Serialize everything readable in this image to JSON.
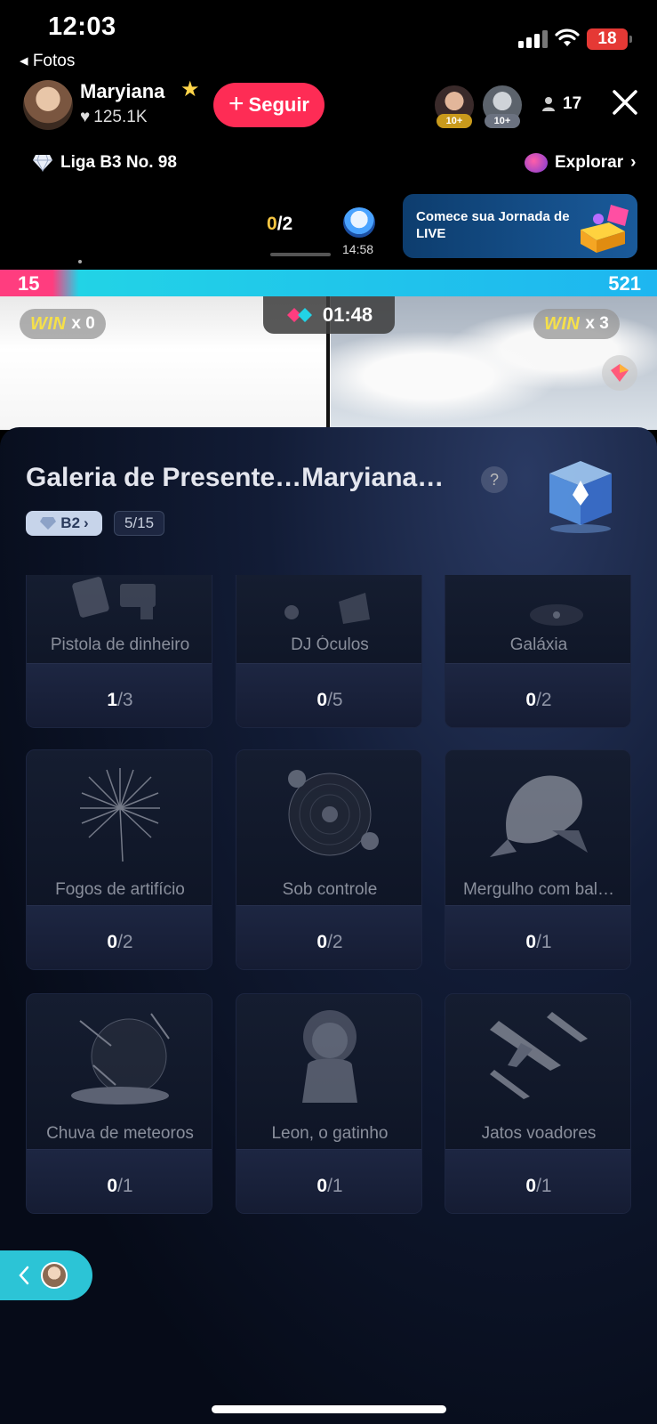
{
  "status_bar": {
    "time": "12:03",
    "battery": "18",
    "back_app": "◂ Fotos"
  },
  "host": {
    "name": "Maryiana",
    "likes": "125.1K",
    "follow_label": "Seguir"
  },
  "viewers": {
    "avatar_badges": [
      "10+",
      "10+"
    ],
    "count": "17"
  },
  "league": {
    "label": "Liga B3 No. 98"
  },
  "explore": {
    "label": "Explorar"
  },
  "mini": {
    "progress_done": "0",
    "progress_total": "/2",
    "time": "14:58"
  },
  "promo": {
    "text": "Comece sua Jornada de LIVE"
  },
  "battle": {
    "score_left": "15",
    "score_right": "521",
    "timer": "01:48",
    "left_win_label": "WIN",
    "left_win_count": "x 0",
    "right_win_label": "WIN",
    "right_win_count": "x 3"
  },
  "gallery": {
    "title": "Galeria de Presente…Maryiana…",
    "help": "?",
    "tier": "B2",
    "collected": "5/15",
    "items": [
      {
        "name": "Pistola de dinheiro",
        "have": "1",
        "total": "/3"
      },
      {
        "name": "DJ Óculos",
        "have": "0",
        "total": "/5"
      },
      {
        "name": "Galáxia",
        "have": "0",
        "total": "/2"
      },
      {
        "name": "Fogos de artifício",
        "have": "0",
        "total": "/2"
      },
      {
        "name": "Sob controle",
        "have": "0",
        "total": "/2"
      },
      {
        "name": "Mergulho com bal…",
        "have": "0",
        "total": "/1"
      },
      {
        "name": "Chuva de meteoros",
        "have": "0",
        "total": "/1"
      },
      {
        "name": "Leon, o gatinho",
        "have": "0",
        "total": "/1"
      },
      {
        "name": "Jatos voadores",
        "have": "0",
        "total": "/1"
      }
    ]
  },
  "colors": {
    "follow": "#fe2c55",
    "panel": "#0c1426",
    "battle_left": "#ff3d7f",
    "battle_right": "#1eb6f0",
    "side_pill": "#2cc4d6"
  }
}
